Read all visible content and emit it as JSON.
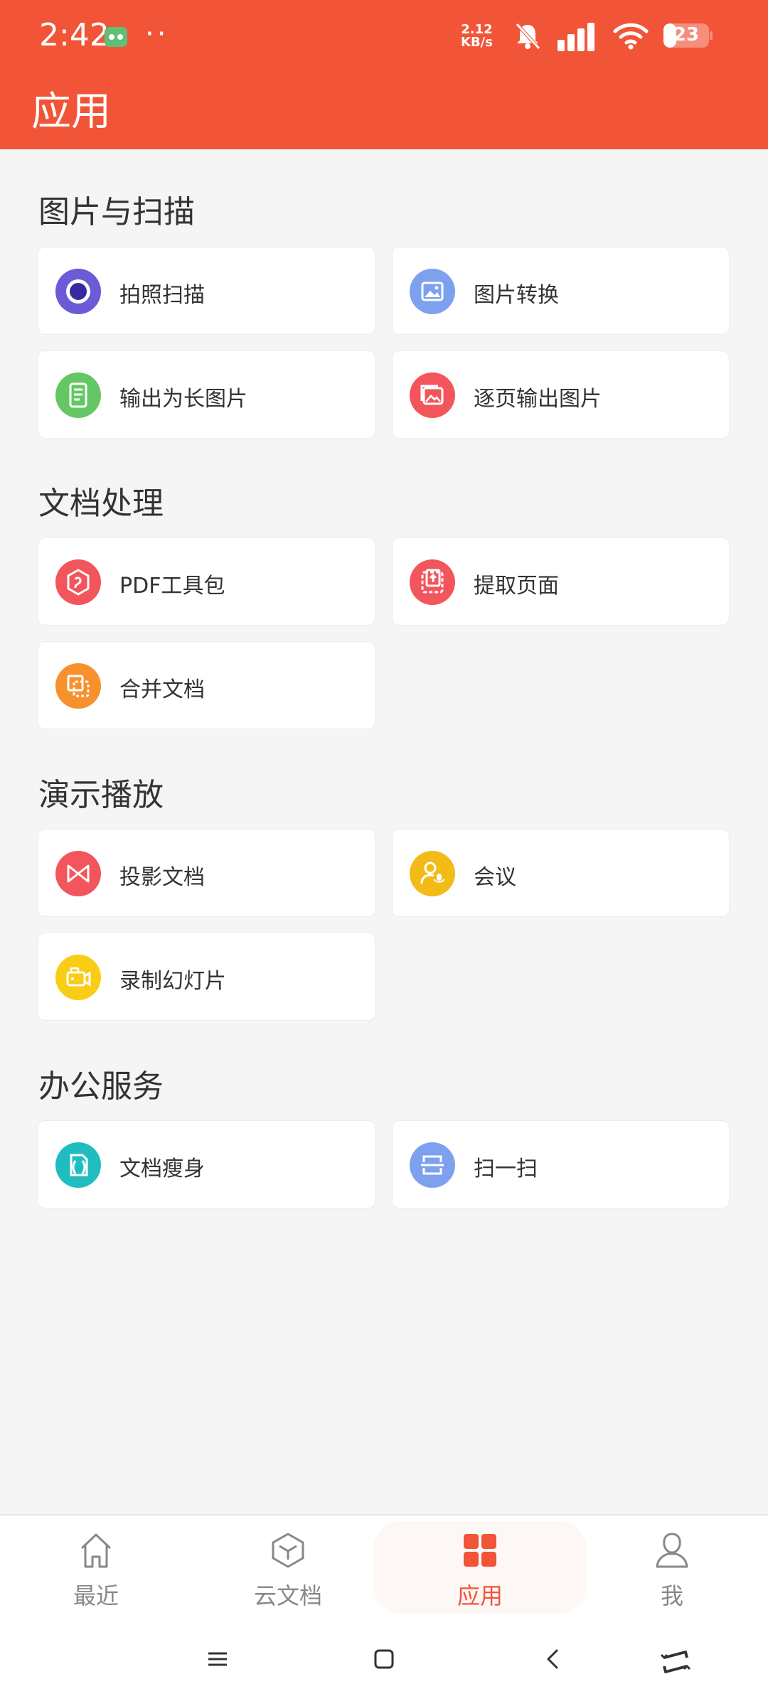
{
  "status_bar": {
    "time": "2:42",
    "extra_dots": "··",
    "net_speed_value": "2.12",
    "net_speed_unit": "KB/s",
    "battery": "23"
  },
  "header": {
    "title": "应用"
  },
  "sections": [
    {
      "title": "图片与扫描",
      "items": [
        {
          "label": "拍照扫描",
          "icon": "camera-scan-icon",
          "color": "#6b5bd6"
        },
        {
          "label": "图片转换",
          "icon": "image-convert-icon",
          "color": "#7ea1ef"
        },
        {
          "label": "输出为长图片",
          "icon": "long-image-icon",
          "color": "#65c764"
        },
        {
          "label": "逐页输出图片",
          "icon": "page-images-icon",
          "color": "#f2555b"
        }
      ]
    },
    {
      "title": "文档处理",
      "items": [
        {
          "label": "PDF工具包",
          "icon": "pdf-toolkit-icon",
          "color": "#f2555b"
        },
        {
          "label": "提取页面",
          "icon": "extract-page-icon",
          "color": "#f2555b"
        },
        {
          "label": "合并文档",
          "icon": "merge-doc-icon",
          "color": "#f7912e"
        }
      ]
    },
    {
      "title": "演示播放",
      "items": [
        {
          "label": "投影文档",
          "icon": "projection-icon",
          "color": "#f2555b"
        },
        {
          "label": "会议",
          "icon": "meeting-icon",
          "color": "#f3bb17"
        },
        {
          "label": "录制幻灯片",
          "icon": "record-slides-icon",
          "color": "#f9cd15"
        }
      ]
    },
    {
      "title": "办公服务",
      "items": [
        {
          "label": "文档瘦身",
          "icon": "doc-slim-icon",
          "color": "#1fbdc0"
        },
        {
          "label": "扫一扫",
          "icon": "qr-scan-icon",
          "color": "#7ea1ef"
        }
      ]
    }
  ],
  "bottom_nav": [
    {
      "label": "最近",
      "icon": "home-icon"
    },
    {
      "label": "云文档",
      "icon": "cloud-doc-icon"
    },
    {
      "label": "应用",
      "icon": "apps-grid-icon",
      "active": true
    },
    {
      "label": "我",
      "icon": "profile-icon"
    }
  ],
  "accent_color": "#f25437"
}
